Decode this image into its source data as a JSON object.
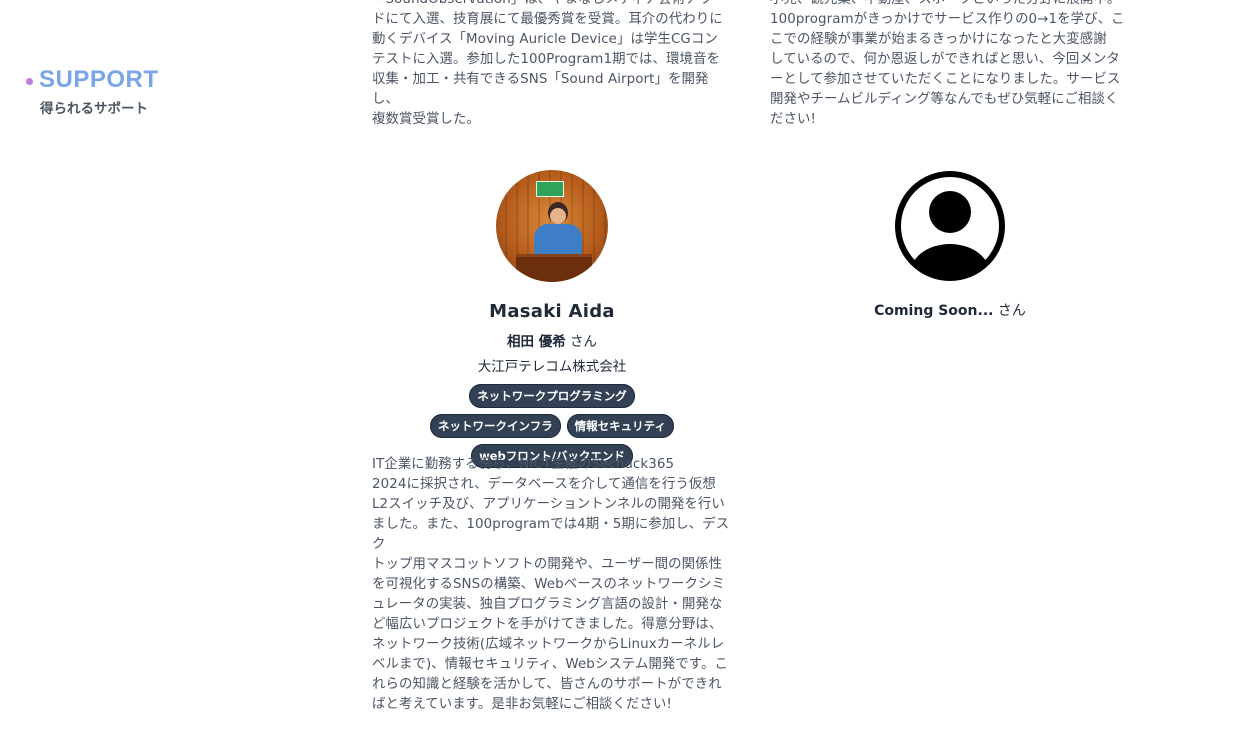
{
  "section": {
    "title": "SUPPORT",
    "subtitle": "得られるサポート"
  },
  "top_bios": {
    "left": "「SoundObservation」は、やまなしメディア芸術アワー\nドにて入選、技育展にて最優秀賞を受賞。耳介の代わりに\n動くデバイス「Moving Auricle Device」は学生CGコン\nテストに入選。参加した100Program1期では、環境音を\n収集・加工・共有できるSNS「Sound Airport」を開発し、\n複数賞受賞した。",
    "right": "小売、観光業、不動産、スポーツといった分野に展開中。\n100programがきっかけでサービス作りの0→1を学び、こ\nこでの経験が事業が始まるきっかけになったと大変感謝\nしているので、何か恩返しができればと思い、今回メンタ\nーとして参加させていただくことになりました。サービス\n開発やチームビルディング等なんでもぜひ気軽にご相談く\nださい!"
  },
  "mentor_aida": {
    "name_en": "Masaki Aida",
    "name_jp": "相田 優希",
    "honorific": " さん",
    "company": "大江戸テレコム株式会社",
    "tags": [
      "ネットワークプログラミング",
      "ネットワークインフラ",
      "情報セキュリティ",
      "webフロント/バックエンド"
    ],
    "bio": "IT企業に勤務する傍ら、NICT主催のSechack365\n2024に採択され、データベースを介して通信を行う仮想\nL2スイッチ及び、アプリケーショントンネルの開発を行い\nました。また、100programでは4期・5期に参加し、デスク\nトップ用マスコットソフトの開発や、ユーザー間の関係性\nを可視化するSNSの構築、Webベースのネットワークシミ\nュレータの実装、独自プログラミング言語の設計・開発な\nど幅広いプロジェクトを手がけてきました。得意分野は、\nネットワーク技術(広域ネットワークからLinuxカーネルレ\nベルまで)、情報セキュリティ、Webシステム開発です。こ\nれらの知識と経験を活かして、皆さんのサポートができれ\nばと考えています。是非お気軽にご相談ください!"
  },
  "mentor_soon": {
    "name_jp": "Coming Soon...",
    "honorific": " さん",
    "avatar_icon": "user-placeholder-icon"
  },
  "colors": {
    "accent": "#7aa6e8",
    "tag_bg": "#334155",
    "text": "#4b5563"
  }
}
